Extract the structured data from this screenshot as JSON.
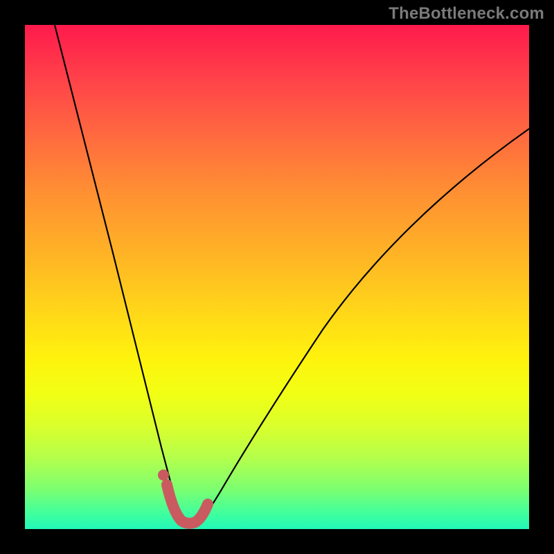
{
  "watermark": {
    "text": "TheBottleneck.com"
  },
  "colors": {
    "page_bg": "#000000",
    "gradient_top": "#ff1a4c",
    "gradient_bottom": "#22f7b8",
    "curve": "#000000",
    "accent": "#c95a60",
    "watermark_text": "#7a7a7a"
  },
  "chart_data": {
    "type": "line",
    "title": "",
    "xlabel": "",
    "ylabel": "",
    "xlim": [
      0,
      100
    ],
    "ylim": [
      0,
      100
    ],
    "grid": false,
    "legend": false,
    "annotations": [
      "TheBottleneck.com"
    ],
    "series": [
      {
        "name": "bottleneck-curve",
        "x": [
          6,
          10,
          14,
          18,
          22,
          25,
          27,
          29,
          30,
          31,
          32,
          33,
          34,
          36,
          38,
          40,
          44,
          50,
          58,
          66,
          76,
          88,
          100
        ],
        "y": [
          100,
          84,
          68,
          52,
          36,
          22,
          14,
          8,
          4,
          2,
          1,
          1,
          2,
          4,
          8,
          12,
          20,
          30,
          42,
          52,
          62,
          72,
          80
        ]
      },
      {
        "name": "accent-segment",
        "x": [
          27.5,
          29,
          30,
          31,
          32,
          33,
          34,
          35
        ],
        "y": [
          9,
          4,
          2,
          1.2,
          1,
          1.2,
          2,
          4
        ]
      }
    ],
    "markers": [
      {
        "name": "accent-start-dot",
        "x": 27.5,
        "y": 9
      }
    ],
    "notes": "y-axis is inverted visually (0 at bottom = green/good, 100 at top = red/bad). Values are estimated from the picture; no axis ticks or numeric labels are shown."
  }
}
